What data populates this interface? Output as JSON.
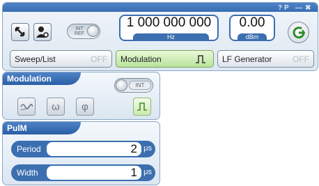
{
  "toolbar": {
    "ref_toggle": {
      "line1": "INT",
      "line2": "REF"
    },
    "frequency": {
      "value": "1 000 000 000",
      "unit": "Hz"
    },
    "level": {
      "value": "0.00",
      "unit": "dBm"
    },
    "title_icons": [
      "?",
      "P",
      "—",
      "✖"
    ]
  },
  "buttons": {
    "sweep": {
      "label": "Sweep/List",
      "state": "OFF"
    },
    "modulation": {
      "label": "Modulation"
    },
    "lf": {
      "label": "LF Generator",
      "state": "OFF"
    }
  },
  "modulation_panel": {
    "title": "Modulation",
    "toggle_label": "INT",
    "types": [
      "am",
      "fm",
      "pm",
      "pulse"
    ]
  },
  "pulm_panel": {
    "title": "PulM",
    "period": {
      "label": "Period",
      "value": "2",
      "unit": "μs"
    },
    "width": {
      "label": "Width",
      "value": "1",
      "unit": "μs"
    }
  }
}
